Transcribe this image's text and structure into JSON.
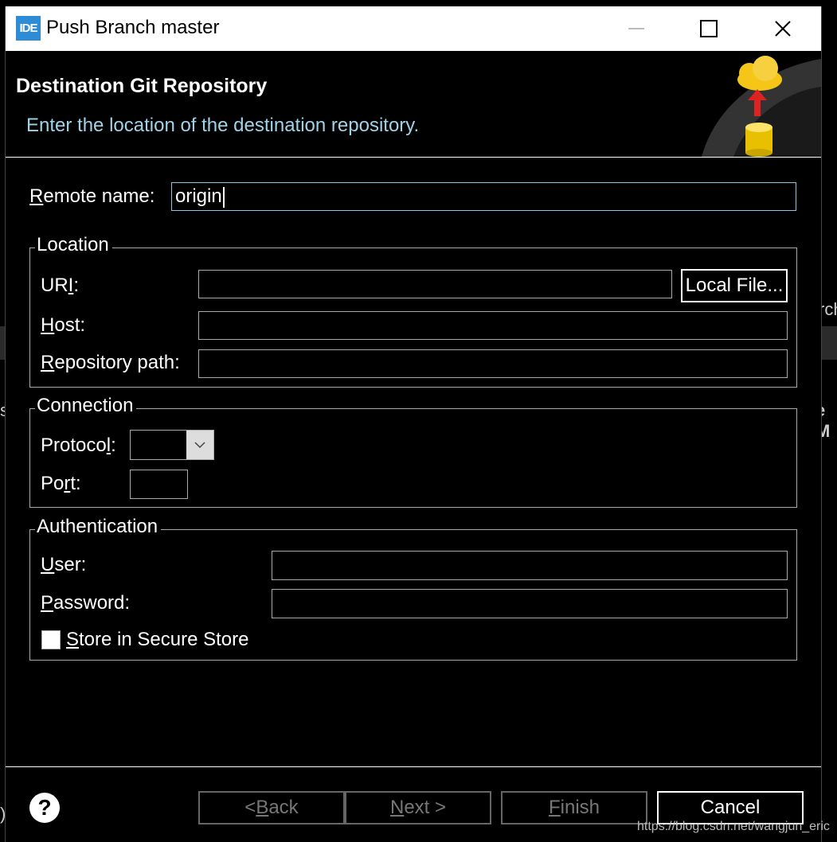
{
  "window": {
    "app_icon_text": "IDE",
    "title": "Push Branch master"
  },
  "banner": {
    "title": "Destination Git Repository",
    "description": "Enter the location of the destination repository."
  },
  "remote": {
    "label_first": "R",
    "label_rest": "emote name:",
    "value": "origin"
  },
  "location": {
    "title": "Location",
    "uri_label_pre": "UR",
    "uri_label_u": "I",
    "uri_label_post": ":",
    "uri_value": "",
    "local_file_button": "Local File...",
    "host_label_u": "H",
    "host_label_rest": "ost:",
    "host_value": "",
    "repo_label_u": "R",
    "repo_label_rest": "epository path:",
    "repo_value": ""
  },
  "connection": {
    "title": "Connection",
    "protocol_label_pre": "Protoco",
    "protocol_label_u": "l",
    "protocol_label_post": ":",
    "protocol_value": "",
    "port_label_pre": "Po",
    "port_label_u": "r",
    "port_label_post": "t:",
    "port_value": ""
  },
  "authentication": {
    "title": "Authentication",
    "user_label_u": "U",
    "user_label_rest": "ser:",
    "user_value": "",
    "password_label_u": "P",
    "password_label_rest": "assword:",
    "password_value": "",
    "store_label_u": "S",
    "store_label_rest": "tore in Secure Store",
    "store_checked": false
  },
  "footer": {
    "back_pre": "< ",
    "back_u": "B",
    "back_rest": "ack",
    "next_u": "N",
    "next_rest": "ext >",
    "finish_u": "F",
    "finish_rest": "inish",
    "cancel": "Cancel"
  },
  "background": {
    "right_text_1": "rch",
    "right_text_2": "e M",
    "left_text_1": "s",
    "left_text_2": ")"
  },
  "watermark": "https://blog.csdn.net/wangjun_eric",
  "colors": {
    "accent": "#2e8bd6",
    "banner_description": "#9fd3e8",
    "focus_border": "#8cc8e6"
  }
}
